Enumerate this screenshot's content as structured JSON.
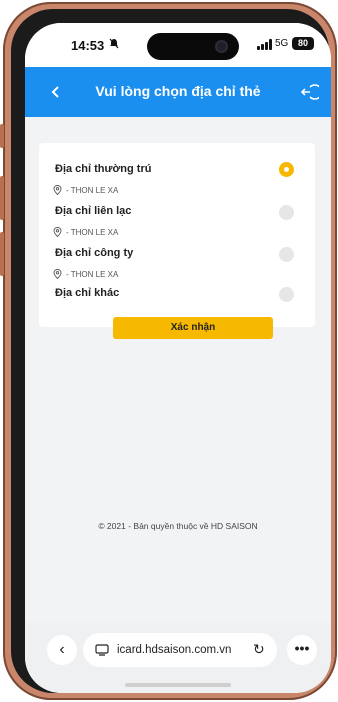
{
  "status_bar": {
    "time": "14:53",
    "network": "5G",
    "battery": "80"
  },
  "header": {
    "title": "Vui lòng chọn địa chỉ thẻ",
    "back_icon": "chevron-left-icon",
    "logout_icon": "logout-icon"
  },
  "address_options": [
    {
      "label": "Địa chỉ thường trú",
      "address": "- THON LE XA",
      "selected": true
    },
    {
      "label": "Địa chỉ liên lạc",
      "address": "- THON LE XA",
      "selected": false
    },
    {
      "label": "Địa chỉ công ty",
      "address": "- THON LE XA",
      "selected": false
    },
    {
      "label": "Địa chỉ khác",
      "selected": false
    }
  ],
  "confirm_button": "Xác nhận",
  "footer": {
    "copyright": "© 2021 - Bản quyền thuộc về HD SAISON"
  },
  "browser": {
    "url": "icard.hdsaison.com.vn",
    "back_label": "‹",
    "more_label": "•••",
    "reload_label": "↻"
  },
  "colors": {
    "header_bg": "#1a8ff0",
    "accent": "#f7b800",
    "frame": "#c9866a"
  }
}
